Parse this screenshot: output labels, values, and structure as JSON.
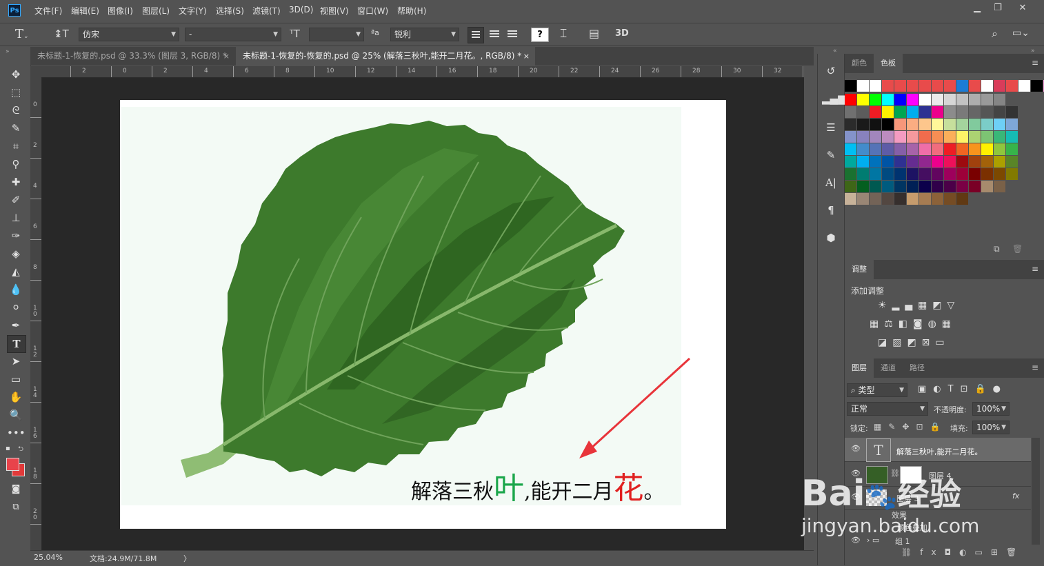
{
  "app": {
    "logo": "Ps"
  },
  "menu": [
    "文件(F)",
    "编辑(E)",
    "图像(I)",
    "图层(L)",
    "文字(Y)",
    "选择(S)",
    "滤镜(T)",
    "3D(D)",
    "视图(V)",
    "窗口(W)",
    "帮助(H)"
  ],
  "window_controls": {
    "minimize": "▁",
    "restore": "❐",
    "close": "✕"
  },
  "options": {
    "font_family": "仿宋",
    "font_style": "-",
    "font_size": "",
    "antialias": "锐利",
    "aa_icon": "ªa",
    "btn_3d": "3D"
  },
  "tabs": [
    {
      "label": "未标题-1-恢复的.psd @ 33.3% (图层 3, RGB/8) *",
      "close": "×",
      "active": false
    },
    {
      "label": "未标题-1-恢复的-恢复的.psd @ 25% (解落三秋叶,能开二月花。, RGB/8) *",
      "close": "×",
      "active": true
    }
  ],
  "ruler": {
    "h_labels": [
      "2",
      "0",
      "2",
      "4",
      "6",
      "8",
      "10",
      "12",
      "14",
      "16",
      "18",
      "20",
      "22",
      "24",
      "26",
      "28",
      "30",
      "32"
    ],
    "v_labels": [
      "0",
      "2",
      "4",
      "6",
      "8",
      "1\n0",
      "1\n2",
      "1\n4",
      "1\n6",
      "1\n8",
      "2\n0"
    ]
  },
  "canvas": {
    "caption_part1": "解落三秋",
    "caption_ye": "叶",
    "caption_part2": ",能开二月",
    "caption_hua": "花",
    "caption_end": "。"
  },
  "status": {
    "zoom": "25.04%",
    "doc": "文档:24.9M/71.8M",
    "arrow": "〉"
  },
  "panels": {
    "color_tabs": [
      "颜色",
      "色板"
    ],
    "adjust_title": "调整",
    "adjust_add": "添加调整",
    "layers_tabs": [
      "图层",
      "通道",
      "路径"
    ],
    "filter_kind": "类型",
    "blend_mode": "正常",
    "opacity_label": "不透明度:",
    "opacity_value": "100%",
    "lock_label": "锁定:",
    "fill_label": "填充:",
    "fill_value": "100%",
    "layers": [
      {
        "name": "解落三秋叶,能开二月花。",
        "type": "text"
      },
      {
        "name": "图层 4",
        "type": "mask"
      },
      {
        "name": "图层 3",
        "type": "fx",
        "fx": "fx"
      },
      {
        "name": "效果",
        "type": "effect"
      },
      {
        "name": "颜色叠加",
        "type": "effect"
      },
      {
        "name": "组 1",
        "type": "group"
      }
    ],
    "layer_footer": [
      "⛓",
      "fx",
      "◘",
      "◐",
      "▭",
      "⊞",
      "🗑"
    ]
  },
  "watermark": {
    "brand": "Bai",
    "paw": "du",
    "jingyan": "经验",
    "url": "jingyan.baidu.com"
  },
  "colors": {
    "accent_red": "#e23a3a",
    "leaf_dark": "#2f6322",
    "leaf_light": "#6fa35a",
    "ye_green": "#1aa64a",
    "hua_red": "#e02020",
    "arrow_red": "#e8343a"
  }
}
